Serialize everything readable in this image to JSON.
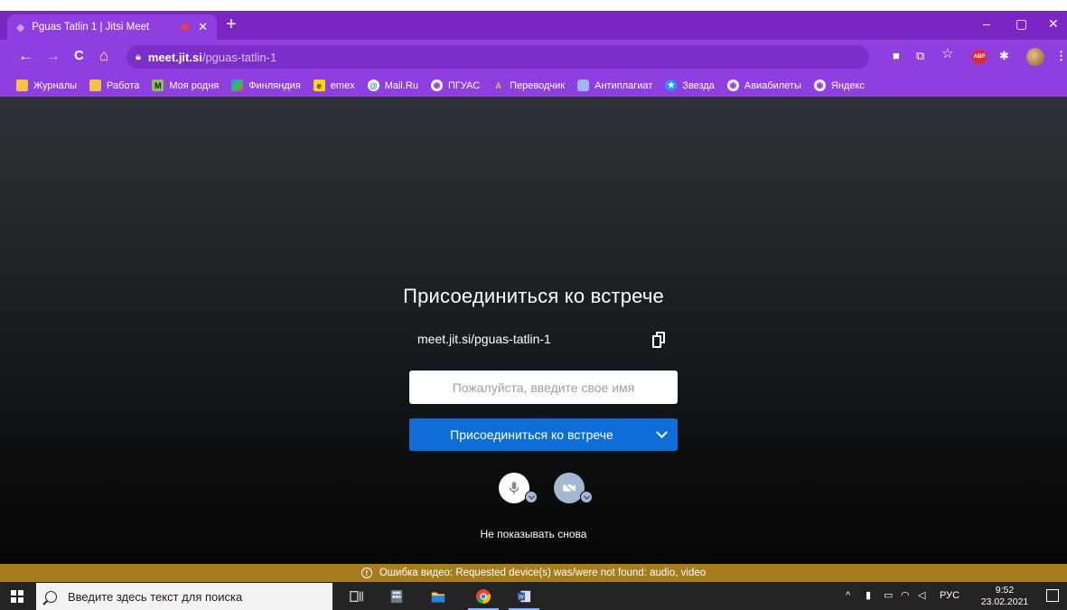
{
  "browser": {
    "tab": {
      "title": "Pguas Tatlin 1 | Jitsi Meet",
      "close_icon": "close-icon",
      "recording_color": "#ff3b3b"
    },
    "new_tab_label": "+",
    "window_controls": {
      "minimize": "–",
      "restore": "▢",
      "close": "✕"
    },
    "address": {
      "host": "meet.jit.si",
      "path": "/pguas-tatlin-1"
    },
    "nav": {
      "back": "←",
      "forward": "→",
      "reload": "C",
      "home": "⌂"
    },
    "toolbar_icons": {
      "camera": "■",
      "install": "⧉",
      "star": "☆",
      "adblock": "ABP",
      "extensions": "✱",
      "menu": "⋮"
    },
    "bookmarks": [
      {
        "label": "Журналы",
        "icon": "folder"
      },
      {
        "label": "Работа",
        "icon": "folder"
      },
      {
        "label": "Моя родня",
        "icon": "green"
      },
      {
        "label": "Финляндия",
        "icon": "map"
      },
      {
        "label": "emex",
        "icon": "emex"
      },
      {
        "label": "Mail.Ru",
        "icon": "mail"
      },
      {
        "label": "ПГУАС",
        "icon": "globe"
      },
      {
        "label": "Переводчик",
        "icon": "trans"
      },
      {
        "label": "Антиплагиат",
        "icon": "shield"
      },
      {
        "label": "Звезда",
        "icon": "star"
      },
      {
        "label": "Авиабилеты",
        "icon": "globe"
      },
      {
        "label": "Яндекс",
        "icon": "globe"
      }
    ],
    "accent_color": "#8f3ee0"
  },
  "prejoin": {
    "title": "Присоединиться ко встрече",
    "meeting_url": "meet.jit.si/pguas-tatlin-1",
    "name_placeholder": "Пожалуйста, введите свое имя",
    "name_value": "",
    "join_label": "Присоединиться ко встрече",
    "dont_show_again": "Не показывать снова",
    "button_color": "#0f6dd8"
  },
  "error_banner": {
    "text": "Ошибка видео: Requested device(s) was/were not found: audio, video",
    "icon": "info-icon",
    "color": "#a67c1d"
  },
  "taskbar": {
    "search_placeholder": "Введите здесь текст для поиска",
    "tray_language": "РУС",
    "time": "9:52",
    "date": "23.02.2021"
  }
}
